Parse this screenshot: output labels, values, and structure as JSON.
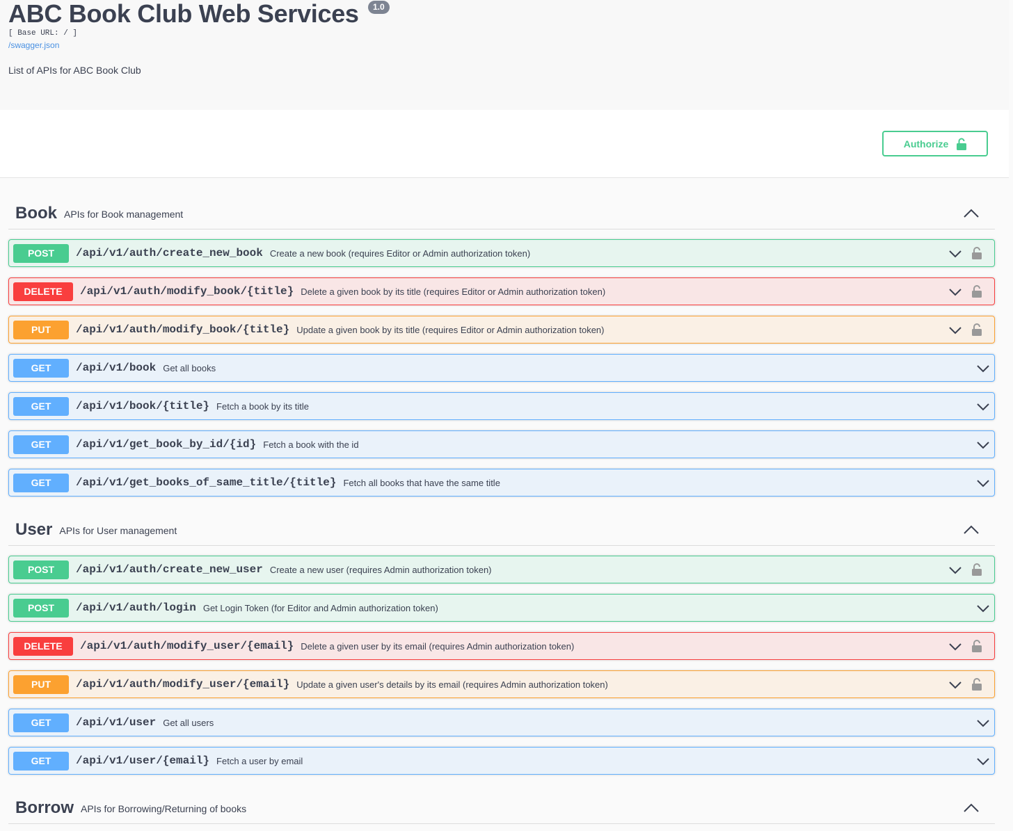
{
  "info": {
    "title": "ABC Book Club Web Services",
    "version": "1.0",
    "base_url": "[ Base URL: / ]",
    "swagger_link": "/swagger.json",
    "description": "List of APIs for ABC Book Club"
  },
  "authorize": {
    "label": "Authorize"
  },
  "tags": [
    {
      "name": "Book",
      "description": "APIs for Book management",
      "operations": [
        {
          "method": "POST",
          "path": "/api/v1/auth/create_new_book",
          "summary": "Create a new book (requires Editor or Admin authorization token)",
          "locked": true
        },
        {
          "method": "DELETE",
          "path": "/api/v1/auth/modify_book/{title}",
          "summary": "Delete a given book by its title (requires Editor or Admin authorization token)",
          "locked": true
        },
        {
          "method": "PUT",
          "path": "/api/v1/auth/modify_book/{title}",
          "summary": "Update a given book by its title (requires Editor or Admin authorization token)",
          "locked": true
        },
        {
          "method": "GET",
          "path": "/api/v1/book",
          "summary": "Get all books",
          "locked": false
        },
        {
          "method": "GET",
          "path": "/api/v1/book/{title}",
          "summary": "Fetch a book by its title",
          "locked": false
        },
        {
          "method": "GET",
          "path": "/api/v1/get_book_by_id/{id}",
          "summary": "Fetch a book with the id",
          "locked": false
        },
        {
          "method": "GET",
          "path": "/api/v1/get_books_of_same_title/{title}",
          "summary": "Fetch all books that have the same title",
          "locked": false
        }
      ]
    },
    {
      "name": "User",
      "description": "APIs for User management",
      "operations": [
        {
          "method": "POST",
          "path": "/api/v1/auth/create_new_user",
          "summary": "Create a new user (requires Admin authorization token)",
          "locked": true
        },
        {
          "method": "POST",
          "path": "/api/v1/auth/login",
          "summary": "Get Login Token (for Editor and Admin authorization token)",
          "locked": false
        },
        {
          "method": "DELETE",
          "path": "/api/v1/auth/modify_user/{email}",
          "summary": "Delete a given user by its email (requires Admin authorization token)",
          "locked": true
        },
        {
          "method": "PUT",
          "path": "/api/v1/auth/modify_user/{email}",
          "summary": "Update a given user's details by its email (requires Admin authorization token)",
          "locked": true
        },
        {
          "method": "GET",
          "path": "/api/v1/user",
          "summary": "Get all users",
          "locked": false
        },
        {
          "method": "GET",
          "path": "/api/v1/user/{email}",
          "summary": "Fetch a user by email",
          "locked": false
        }
      ]
    },
    {
      "name": "Borrow",
      "description": "APIs for Borrowing/Returning of books",
      "operations": []
    }
  ]
}
